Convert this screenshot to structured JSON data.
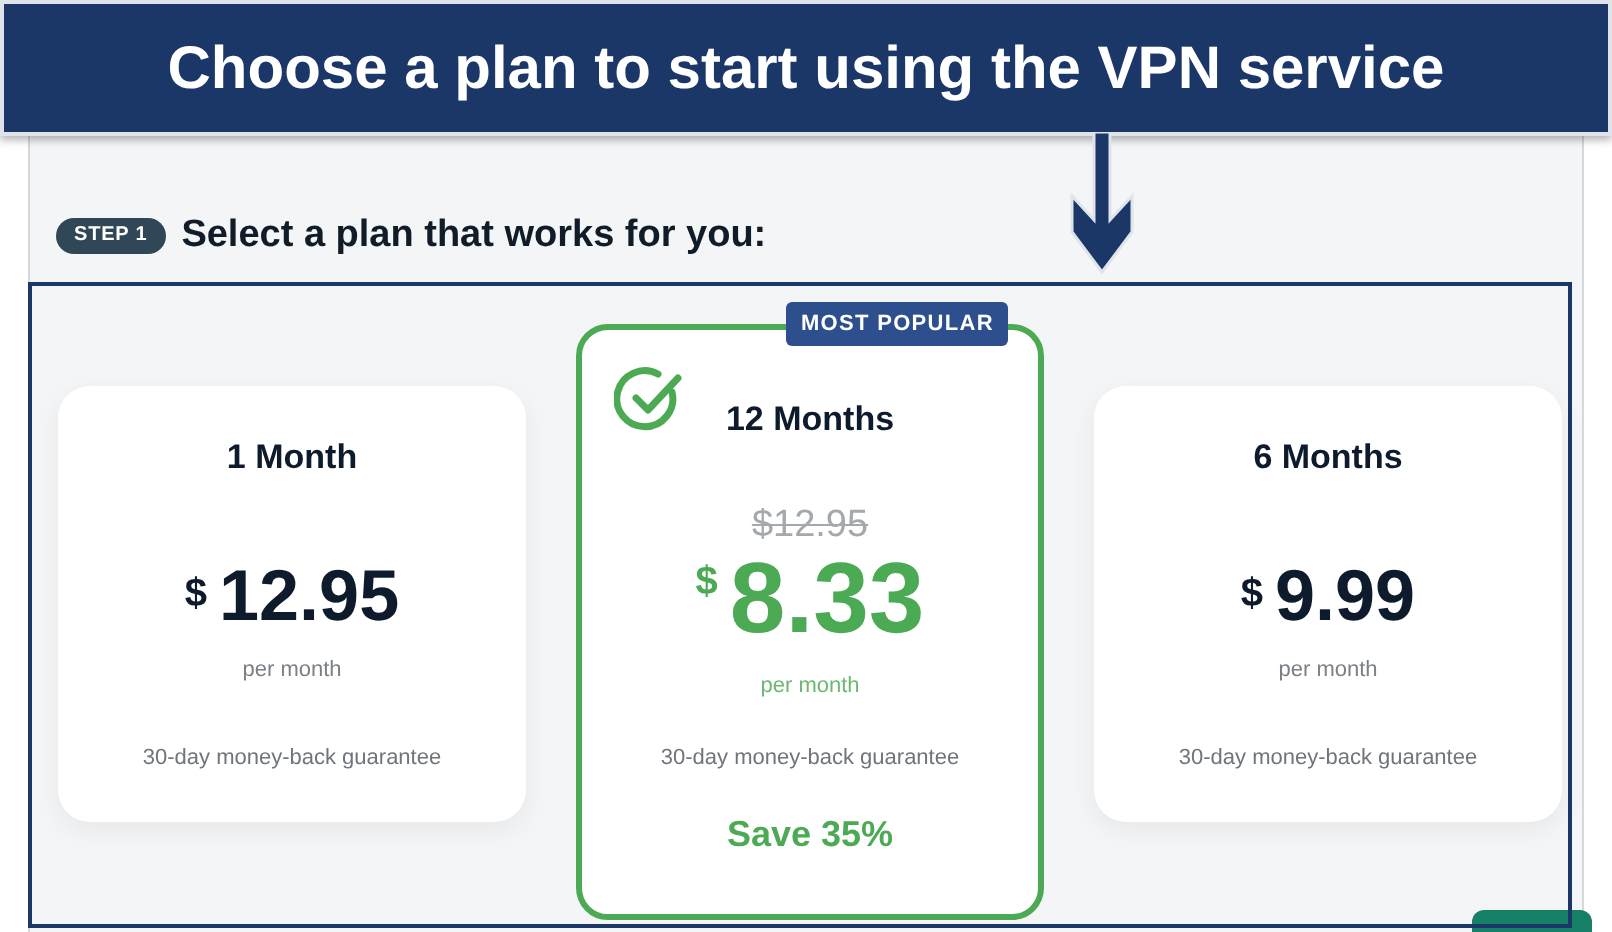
{
  "banner": {
    "title": "Choose a plan to start using the VPN service"
  },
  "step": {
    "badge": "STEP 1",
    "title": "Select a plan that works for you:"
  },
  "plans": [
    {
      "name": "1 Month",
      "selected": false,
      "currency": "$",
      "amount": "12.95",
      "period": "per month",
      "guarantee": "30-day money-back guarantee"
    },
    {
      "name": "12 Months",
      "selected": true,
      "badge": "MOST POPULAR",
      "original_price": "$12.95",
      "currency": "$",
      "amount": "8.33",
      "period": "per month",
      "guarantee": "30-day money-back guarantee",
      "savings": "Save 35%"
    },
    {
      "name": "6 Months",
      "selected": false,
      "currency": "$",
      "amount": "9.99",
      "period": "per month",
      "guarantee": "30-day money-back guarantee"
    }
  ]
}
